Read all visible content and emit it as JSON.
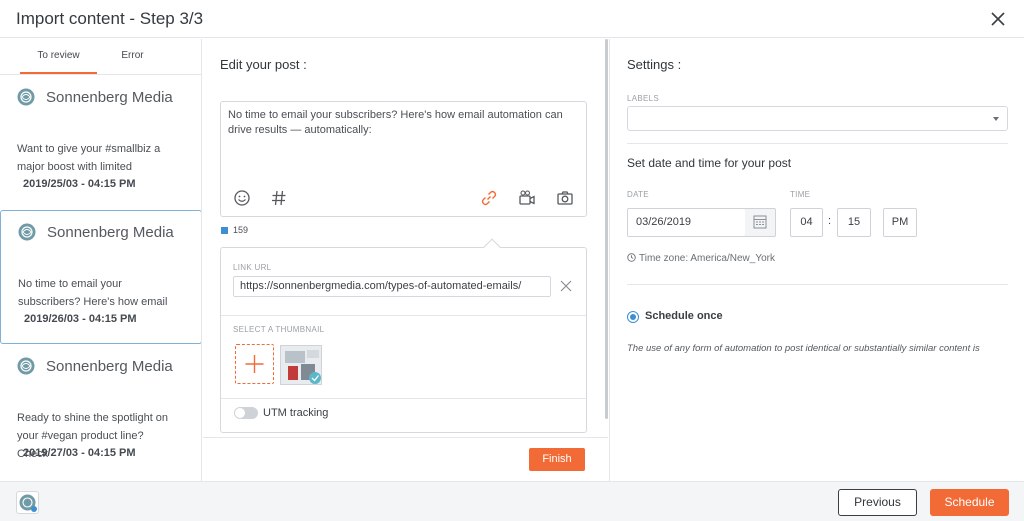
{
  "header": {
    "title": "Import content - Step 3/3"
  },
  "tabs": [
    {
      "label": "To review"
    },
    {
      "label": "Error"
    }
  ],
  "posts": [
    {
      "name": "Sonnenberg Media",
      "text": "Want to give your #smallbiz a major boost with limited",
      "date": "2019/25/03 - 04:15 PM"
    },
    {
      "name": "Sonnenberg Media",
      "text": "No time to email your subscribers? Here's how email",
      "date": "2019/26/03 - 04:15 PM"
    },
    {
      "name": "Sonnenberg Media",
      "text": "Ready to shine the spotlight on your #vegan product line? Check",
      "date": "2019/27/03 - 04:15 PM"
    }
  ],
  "editor": {
    "title": "Edit your post :",
    "text": "No time to email your subscribers? Here's how email automation can drive results — automatically:",
    "char_count": "159",
    "link_label": "LINK URL",
    "link_url": "https://sonnenbergmedia.com/types-of-automated-emails/",
    "thumb_label": "SELECT A THUMBNAIL",
    "utm_label": "UTM tracking",
    "utm_enabled": false,
    "finish_label": "Finish"
  },
  "settings": {
    "title": "Settings :",
    "labels_label": "LABELS",
    "labels_value": "",
    "datetime_title": "Set date and time for your post",
    "date_label": "DATE",
    "date_value": "03/26/2019",
    "time_label": "TIME",
    "hour": "04",
    "minute": "15",
    "ampm": "PM",
    "timezone": "Time zone: America/New_York",
    "schedule_option": "Schedule once",
    "note": "The use of any form of automation to post identical or substantially similar content is"
  },
  "footer": {
    "previous_label": "Previous",
    "schedule_label": "Schedule"
  },
  "colors": {
    "accent": "#f26a35",
    "selected_border": "#7fb2d6",
    "radio": "#3d8fd1"
  }
}
